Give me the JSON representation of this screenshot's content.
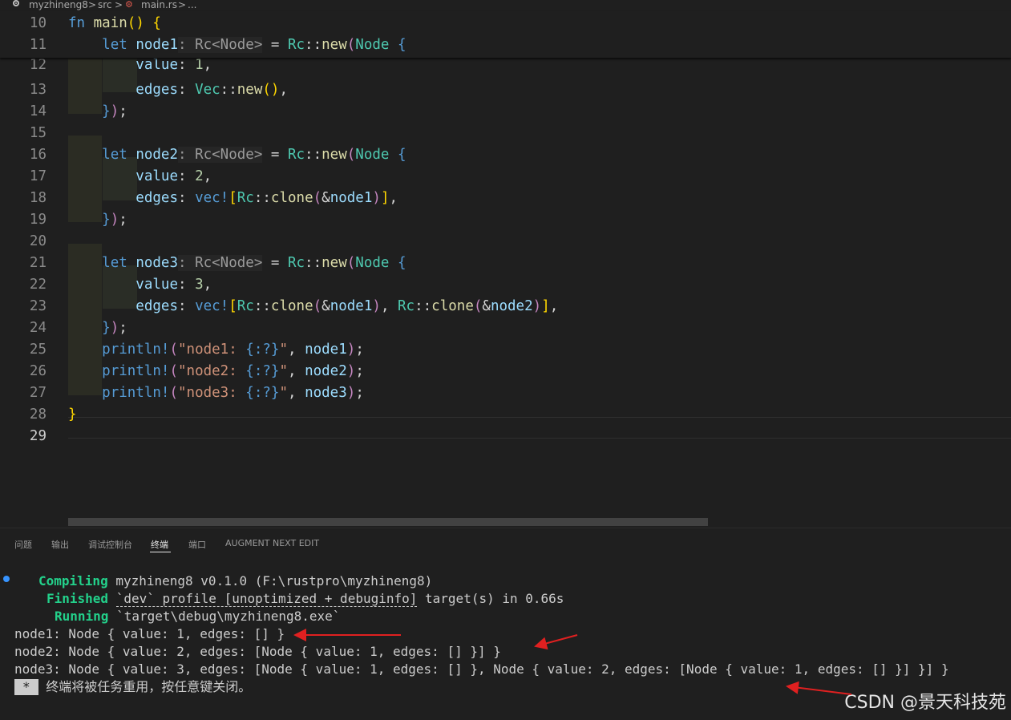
{
  "breadcrumb": {
    "project": "myzhineng8",
    "folder": "src",
    "file": "main.rs",
    "more": "...",
    "sep": ">"
  },
  "editor": {
    "current_line": 29,
    "sticky": [
      {
        "n": "10",
        "html": "<span class=\"k\">fn</span> <span class=\"f\">main</span><span class=\"y\">()</span> <span class=\"y\">{</span>"
      },
      {
        "n": "11",
        "html": "    <span class=\"k\">let</span> <span class=\"v\">node1</span><span class=\"hint\">: Rc&lt;Node&gt;</span> = <span class=\"t\">Rc</span>::<span class=\"f\">new</span><span class=\"m\">(</span><span class=\"t\">Node</span> <span class=\"k\">{</span>"
      }
    ],
    "lines": [
      {
        "n": "12",
        "html": "        <span class=\"v\">value</span>: <span class=\"n\">1</span>,"
      },
      {
        "n": "13",
        "html": "        <span class=\"v\">edges</span>: <span class=\"t\">Vec</span>::<span class=\"f\">new</span><span class=\"y\">()</span>,"
      },
      {
        "n": "14",
        "html": "    <span class=\"k\">}</span><span class=\"m\">)</span>;"
      },
      {
        "n": "15",
        "html": ""
      },
      {
        "n": "16",
        "html": "    <span class=\"k\">let</span> <span class=\"v\">node2</span><span class=\"hint\">: Rc&lt;Node&gt;</span> = <span class=\"t\">Rc</span>::<span class=\"f\">new</span><span class=\"m\">(</span><span class=\"t\">Node</span> <span class=\"k\">{</span>"
      },
      {
        "n": "17",
        "html": "        <span class=\"v\">value</span>: <span class=\"n\">2</span>,"
      },
      {
        "n": "18",
        "html": "        <span class=\"v\">edges</span>: <span class=\"k\">vec!</span><span class=\"y\">[</span><span class=\"t\">Rc</span>::<span class=\"f\">clone</span><span class=\"m\">(</span>&amp;<span class=\"v\">node1</span><span class=\"m\">)</span><span class=\"y\">]</span>,"
      },
      {
        "n": "19",
        "html": "    <span class=\"k\">}</span><span class=\"m\">)</span>;"
      },
      {
        "n": "20",
        "html": ""
      },
      {
        "n": "21",
        "html": "    <span class=\"k\">let</span> <span class=\"v\">node3</span><span class=\"hint\">: Rc&lt;Node&gt;</span> = <span class=\"t\">Rc</span>::<span class=\"f\">new</span><span class=\"m\">(</span><span class=\"t\">Node</span> <span class=\"k\">{</span>"
      },
      {
        "n": "22",
        "html": "        <span class=\"v\">value</span>: <span class=\"n\">3</span>,"
      },
      {
        "n": "23",
        "html": "        <span class=\"v\">edges</span>: <span class=\"k\">vec!</span><span class=\"y\">[</span><span class=\"t\">Rc</span>::<span class=\"f\">clone</span><span class=\"m\">(</span>&amp;<span class=\"v\">node1</span><span class=\"m\">)</span>, <span class=\"t\">Rc</span>::<span class=\"f\">clone</span><span class=\"m\">(</span>&amp;<span class=\"v\">node2</span><span class=\"m\">)</span><span class=\"y\">]</span>,"
      },
      {
        "n": "24",
        "html": "    <span class=\"k\">}</span><span class=\"m\">)</span>;"
      },
      {
        "n": "25",
        "html": "    <span class=\"k\">println!</span><span class=\"m\">(</span><span class=\"s\">\"node1: </span><span class=\"k\">{:?}</span><span class=\"s\">\"</span>, <span class=\"v\">node1</span><span class=\"m\">)</span>;"
      },
      {
        "n": "26",
        "html": "    <span class=\"k\">println!</span><span class=\"m\">(</span><span class=\"s\">\"node2: </span><span class=\"k\">{:?}</span><span class=\"s\">\"</span>, <span class=\"v\">node2</span><span class=\"m\">)</span>;"
      },
      {
        "n": "27",
        "html": "    <span class=\"k\">println!</span><span class=\"m\">(</span><span class=\"s\">\"node3: </span><span class=\"k\">{:?}</span><span class=\"s\">\"</span>, <span class=\"v\">node3</span><span class=\"m\">)</span>;"
      },
      {
        "n": "28",
        "html": "<span class=\"y\">}</span>"
      },
      {
        "n": "29",
        "html": ""
      }
    ]
  },
  "panel": {
    "tabs": [
      {
        "label": "问题",
        "active": false
      },
      {
        "label": "输出",
        "active": false
      },
      {
        "label": "调试控制台",
        "active": false
      },
      {
        "label": "终端",
        "active": true
      },
      {
        "label": "端口",
        "active": false
      },
      {
        "label": "AUGMENT NEXT EDIT",
        "active": false
      }
    ]
  },
  "terminal": {
    "compiling_label": "Compiling",
    "compiling_text": " myzhineng8 v0.1.0 (F:\\rustpro\\myzhineng8)",
    "finished_label": "Finished",
    "finished_profile": "`dev` profile [unoptimized + debuginfo]",
    "finished_text": " target(s) in 0.66s",
    "running_label": "Running",
    "running_text": " `target\\debug\\myzhineng8.exe`",
    "out1": "node1: Node { value: 1, edges: [] }",
    "out2": "node2: Node { value: 2, edges: [Node { value: 1, edges: [] }] }",
    "out3": "node3: Node { value: 3, edges: [Node { value: 1, edges: [] }, Node { value: 2, edges: [Node { value: 1, edges: [] }] }] }",
    "star": "*",
    "reuse_message": "终端将被任务重用，按任意键关闭。"
  },
  "watermark": "CSDN @景天科技苑",
  "colors": {
    "background": "#1f1f1f",
    "keyword": "#569cd6",
    "type": "#4ec9b0",
    "terminal_green": "#23d18b",
    "annotation_arrow": "#e02020"
  }
}
